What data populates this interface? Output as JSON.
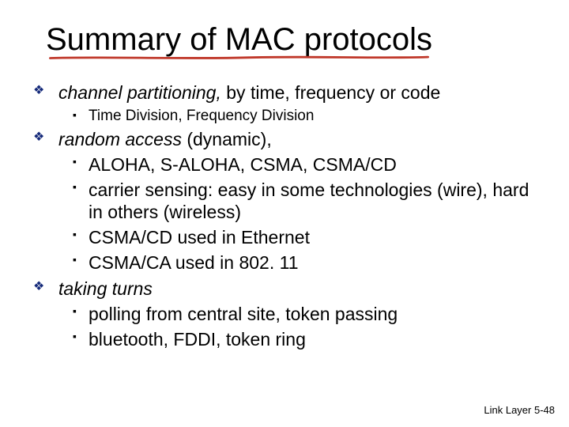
{
  "title": "Summary of MAC protocols",
  "bullets": {
    "b1": {
      "lead": "channel partitioning,",
      "rest": " by time, frequency or code",
      "sub1": "Time Division, Frequency Division"
    },
    "b2": {
      "lead": "random access",
      "rest": " (dynamic),",
      "sub1": "ALOHA, S-ALOHA, CSMA, CSMA/CD",
      "sub2": "carrier sensing: easy in some technologies (wire), hard in others (wireless)",
      "sub3": "CSMA/CD used in Ethernet",
      "sub4": "CSMA/CA used in 802. 11"
    },
    "b3": {
      "lead": "taking turns",
      "sub1": "polling from central site, token passing",
      "sub2": "bluetooth, FDDI,  token ring"
    }
  },
  "footer": "Link Layer  5-48"
}
